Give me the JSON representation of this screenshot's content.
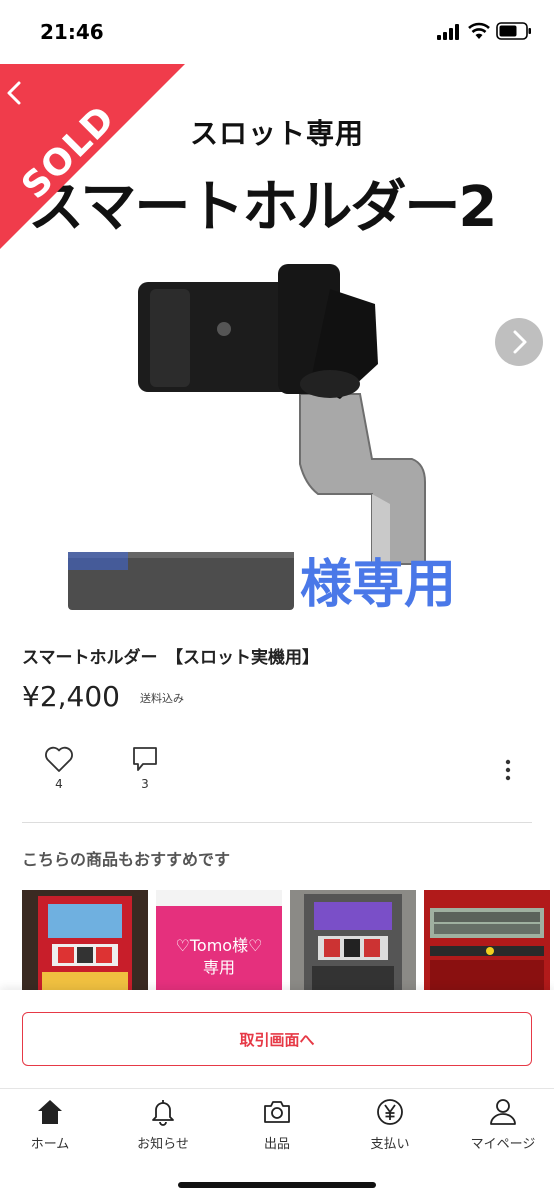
{
  "status_bar": {
    "time": "21:46",
    "icons": [
      "signal-icon",
      "wifi-icon",
      "battery-icon"
    ]
  },
  "hero": {
    "subtitle": "スロット専用",
    "title": "スマートホルダー2",
    "overlay_text": "様専用",
    "badge": "SOLD",
    "badge_color": "#f03c4b"
  },
  "item": {
    "title": "スマートホルダー　【スロット実機用】",
    "price": "¥2,400",
    "shipping": "送料込み",
    "likes": "4",
    "comments": "3"
  },
  "recommend": {
    "heading": "こちらの商品もおすすめです",
    "cards": [
      {
        "type": "slot-machine-photo"
      },
      {
        "type": "text-card",
        "line1": "♡Tomo様♡",
        "line2": "専用",
        "bg": "#e5307d"
      },
      {
        "type": "slot-machine-photo"
      },
      {
        "type": "counter-display-photo"
      }
    ]
  },
  "actions": {
    "trade_button": "取引画面へ",
    "accent": "#e63946"
  },
  "tab_bar": {
    "items": [
      {
        "label": "ホーム",
        "icon": "home-icon"
      },
      {
        "label": "お知らせ",
        "icon": "bell-icon"
      },
      {
        "label": "出品",
        "icon": "camera-icon"
      },
      {
        "label": "支払い",
        "icon": "yen-icon"
      },
      {
        "label": "マイページ",
        "icon": "person-icon"
      }
    ]
  }
}
